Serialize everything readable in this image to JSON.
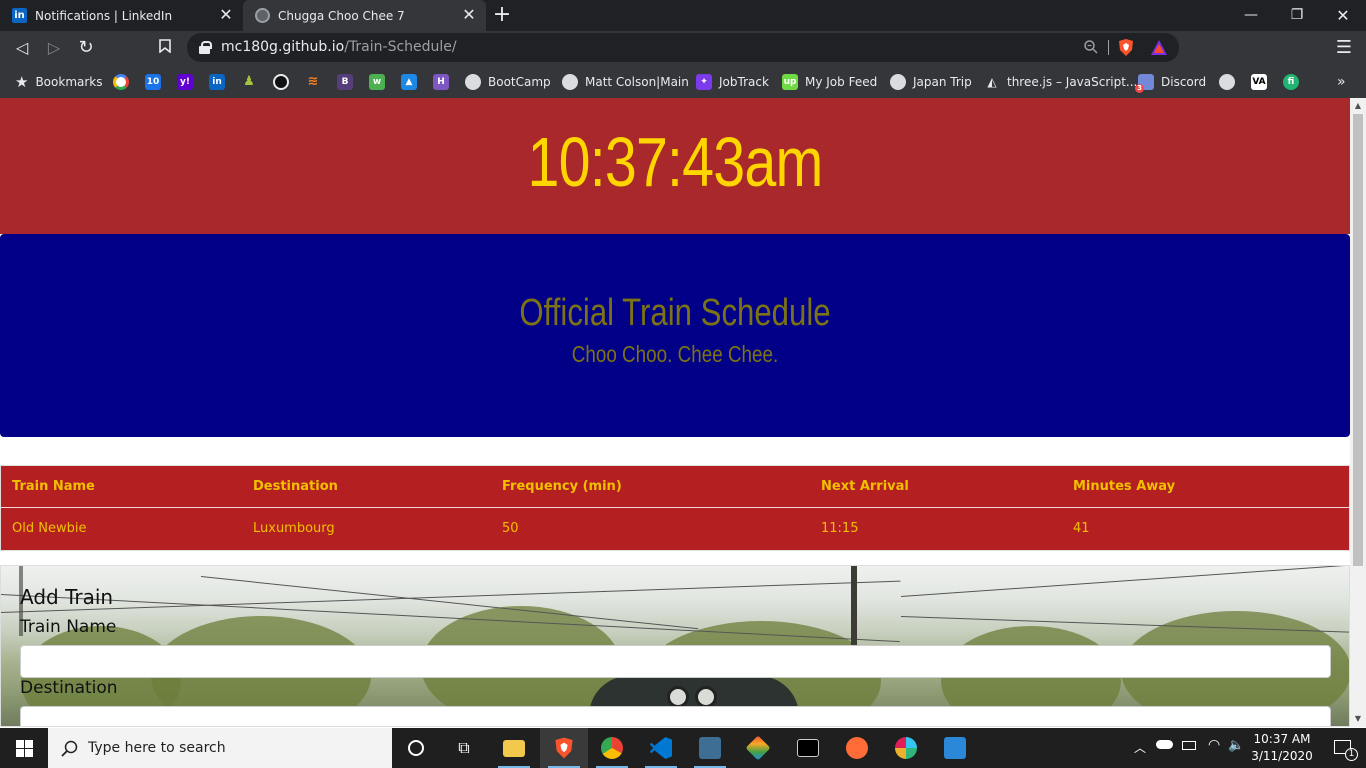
{
  "browser": {
    "tabs": [
      {
        "title": "Notifications | LinkedIn",
        "active": false
      },
      {
        "title": "Chugga Choo Chee 7",
        "active": true
      }
    ],
    "new_tab": "+",
    "url_host": "mc180g.github.io",
    "url_path": "/Train-Schedule/",
    "bookmarks_label": "Bookmarks",
    "bookmarks": [
      {
        "label": "BootCamp"
      },
      {
        "label": "Matt Colson|Main"
      },
      {
        "label": "JobTrack"
      },
      {
        "label": "My Job Feed"
      },
      {
        "label": "Japan Trip"
      },
      {
        "label": "three.js – JavaScript..."
      },
      {
        "label": "Discord"
      }
    ],
    "bookmark_icon_labels": {
      "cal": "10",
      "yahoo": "y!",
      "linkedin": "in",
      "bootstrap": "B",
      "hackernoon": "H",
      "upwork": "up",
      "vimeo": "VA",
      "discord_badge": "3",
      "fi": "fi"
    },
    "overflow": "»"
  },
  "page": {
    "clock": "10:37:43am",
    "title": "Official Train Schedule",
    "subtitle": "Choo Choo. Chee Chee.",
    "table": {
      "headers": [
        "Train Name",
        "Destination",
        "Frequency (min)",
        "Next Arrival",
        "Minutes Away"
      ],
      "rows": [
        [
          "Old Newbie",
          "Luxumbourg",
          "50",
          "11:15",
          "41"
        ]
      ]
    },
    "form": {
      "title": "Add Train",
      "train_name_label": "Train Name",
      "destination_label": "Destination",
      "train_name_value": "",
      "destination_value": ""
    }
  },
  "taskbar": {
    "search_placeholder": "Type here to search",
    "time": "10:37 AM",
    "date": "3/11/2020",
    "notification_count": "1"
  }
}
